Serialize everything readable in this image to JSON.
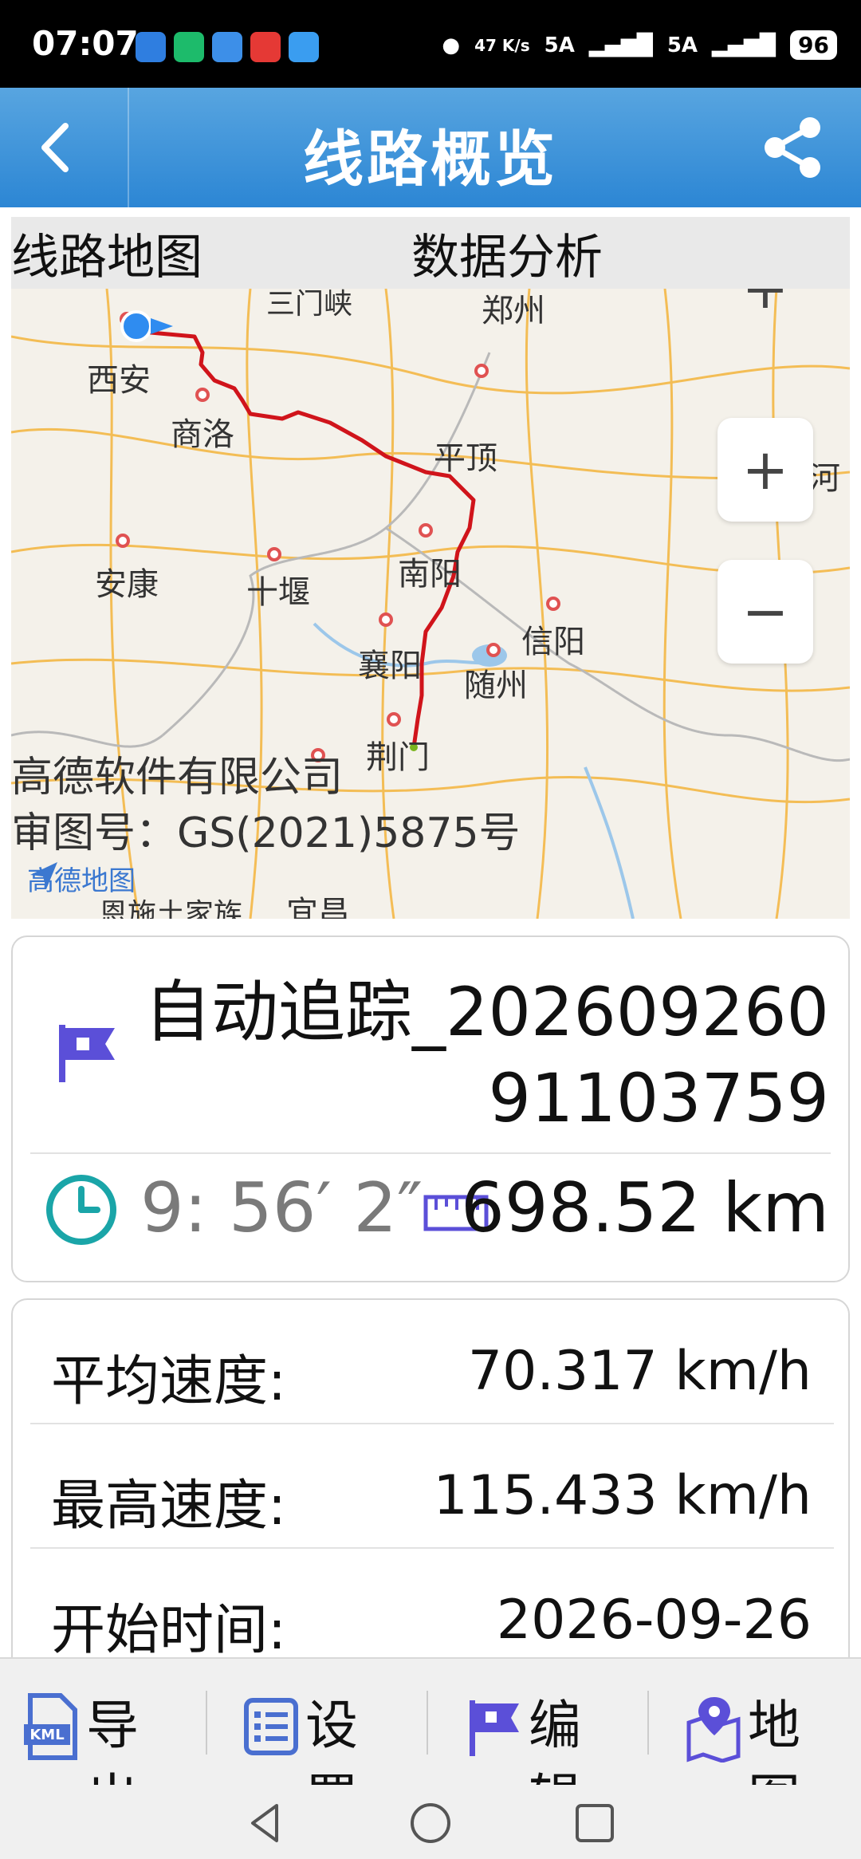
{
  "status_bar": {
    "time": "07:07",
    "net_speed": "47 K/s",
    "signal1": "5A",
    "signal2": "5A",
    "battery": "96"
  },
  "header": {
    "title": "线路概览",
    "back_icon": "back-chevron-icon",
    "share_icon": "share-icon"
  },
  "tabs": [
    {
      "label": "线路地图"
    },
    {
      "label": "数据分析"
    }
  ],
  "map": {
    "cities": [
      "西安",
      "三门峡",
      "郑州",
      "商洛",
      "平顶",
      "河",
      "南阳",
      "安康",
      "十堰",
      "信阳",
      "襄阳",
      "随州",
      "荆门",
      "宜昌",
      "恩施土家族"
    ],
    "zoom_in": "+",
    "zoom_out": "−",
    "credit_line1": "高德软件有限公司",
    "credit_line2": "审图号：GS(2021)5875号",
    "logo_text": "高德地图",
    "route_color": "#d0141b"
  },
  "track": {
    "name": "自动追踪_20260926091103759",
    "duration": "9: 56′ 2″",
    "distance": "698.52 km"
  },
  "stats": [
    {
      "label": "平均速度:",
      "value": "70.317 km/h"
    },
    {
      "label": "最高速度:",
      "value": "115.433 km/h"
    },
    {
      "label": "开始时间:",
      "value": "2026-09-26"
    }
  ],
  "toolbar": [
    {
      "label": "导出",
      "icon": "kml-file-icon"
    },
    {
      "label": "设置",
      "icon": "list-icon"
    },
    {
      "label": "编辑",
      "icon": "flag-icon"
    },
    {
      "label": "地图",
      "icon": "map-pin-icon"
    }
  ]
}
